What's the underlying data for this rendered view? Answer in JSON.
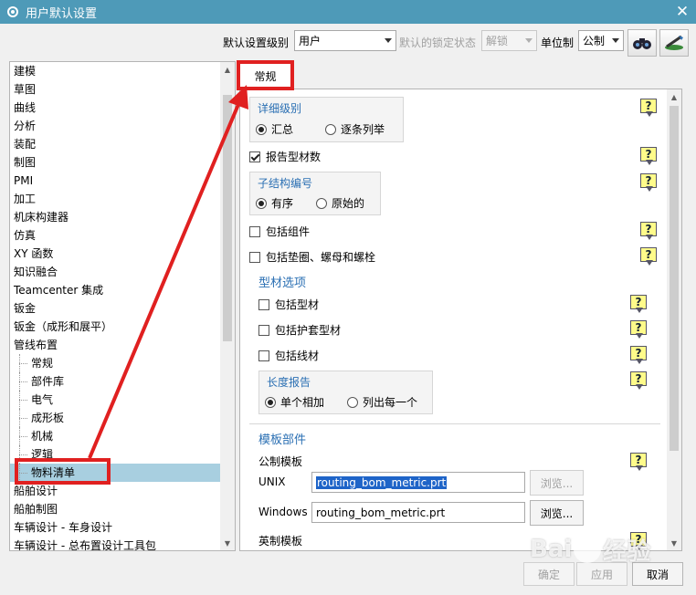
{
  "window": {
    "title": "用户默认设置"
  },
  "toolbar": {
    "level_label": "默认设置级别",
    "level_value": "用户",
    "lock_label": "默认的锁定状态",
    "lock_value": "解锁",
    "unit_label": "单位制",
    "unit_value": "公制"
  },
  "tree": {
    "items": [
      {
        "label": "建模"
      },
      {
        "label": "草图"
      },
      {
        "label": "曲线"
      },
      {
        "label": "分析"
      },
      {
        "label": "装配"
      },
      {
        "label": "制图"
      },
      {
        "label": "PMI"
      },
      {
        "label": "加工"
      },
      {
        "label": "机床构建器"
      },
      {
        "label": "仿真"
      },
      {
        "label": "XY 函数"
      },
      {
        "label": "知识融合"
      },
      {
        "label": "Teamcenter 集成"
      },
      {
        "label": "钣金"
      },
      {
        "label": "钣金（成形和展平）"
      },
      {
        "label": "管线布置"
      },
      {
        "label": "常规"
      },
      {
        "label": "部件库"
      },
      {
        "label": "电气"
      },
      {
        "label": "成形板"
      },
      {
        "label": "机械"
      },
      {
        "label": "逻辑"
      },
      {
        "label": "物料清单"
      },
      {
        "label": "船舶设计"
      },
      {
        "label": "船舶制图"
      },
      {
        "label": "车辆设计 - 车身设计"
      },
      {
        "label": "车辆设计 - 总布置设计工具包"
      }
    ]
  },
  "tabs": [
    {
      "label": "常规"
    }
  ],
  "panel": {
    "detail_level": {
      "title": "详细级别",
      "opt1": "汇总",
      "opt2": "逐条列举",
      "selected": "汇总"
    },
    "report_profile_count": {
      "label": "报告型材数",
      "checked": true
    },
    "sub_structure_numbering": {
      "title": "子结构编号",
      "opt1": "有序",
      "opt2": "原始的",
      "selected": "有序"
    },
    "include_components": {
      "label": "包括组件",
      "checked": false
    },
    "include_gaskets": {
      "label": "包括垫圈、螺母和螺栓",
      "checked": false
    },
    "profile_options": {
      "title": "型材选项",
      "include_profile": {
        "label": "包括型材",
        "checked": false
      },
      "include_sheathing": {
        "label": "包括护套型材",
        "checked": false
      },
      "include_wire": {
        "label": "包括线材",
        "checked": false
      },
      "length_report": {
        "title": "长度报告",
        "opt1": "单个相加",
        "opt2": "列出每一个",
        "selected": "单个相加"
      }
    },
    "template_parts": {
      "title": "模板部件",
      "metric_title": "公制模板",
      "unix_label": "UNIX",
      "unix_value": "routing_bom_metric.prt",
      "browse_label": "浏览...",
      "windows_label": "Windows",
      "windows_value": "routing_bom_metric.prt",
      "english_title": "英制模板"
    },
    "help_glyph": "?"
  },
  "buttons": {
    "ok": "确定",
    "apply": "应用",
    "cancel": "取消"
  },
  "watermark": {
    "text1": "Bai",
    "text2": "经验"
  },
  "colors": {
    "titlebar": "#4e9ab8",
    "section_title": "#2a6fb3",
    "selection": "#a8cfe0",
    "highlight_box": "#e02020",
    "help_bg": "#fffb8a"
  }
}
